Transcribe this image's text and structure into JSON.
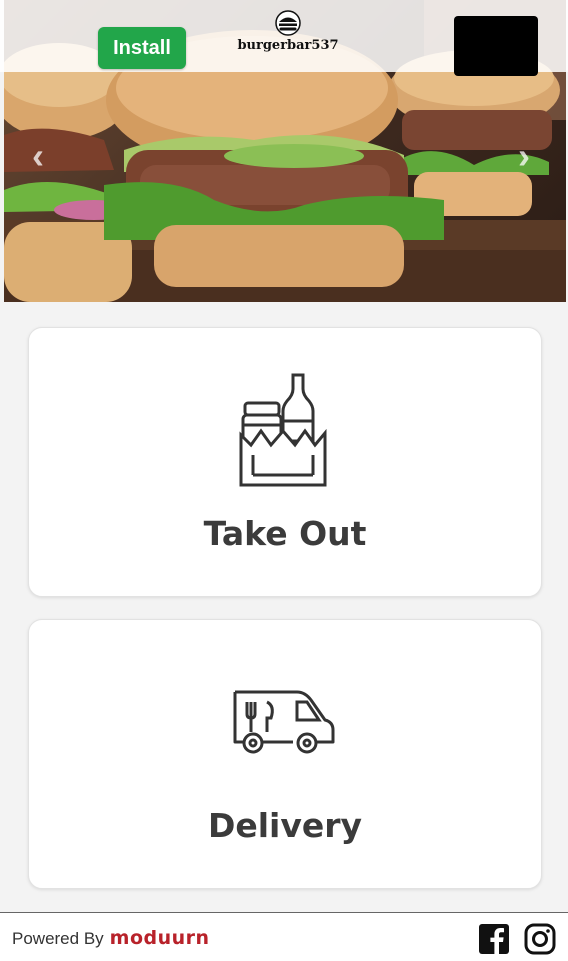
{
  "header": {
    "install_label": "Install",
    "brand_name_part1": "burgerbar",
    "brand_name_part2": "537"
  },
  "hero": {
    "prev_icon": "chevron-left-icon",
    "next_icon": "chevron-right-icon"
  },
  "options": [
    {
      "label": "Take Out",
      "icon": "takeout-bag-icon"
    },
    {
      "label": "Delivery",
      "icon": "delivery-truck-icon"
    }
  ],
  "footer": {
    "powered_by": "Powered By",
    "provider": "moduurn",
    "social": [
      "facebook-icon",
      "instagram-icon"
    ]
  },
  "colors": {
    "install_green": "#22a64a",
    "label_gray": "#3b3b3b",
    "provider_red": "#b8222a"
  }
}
